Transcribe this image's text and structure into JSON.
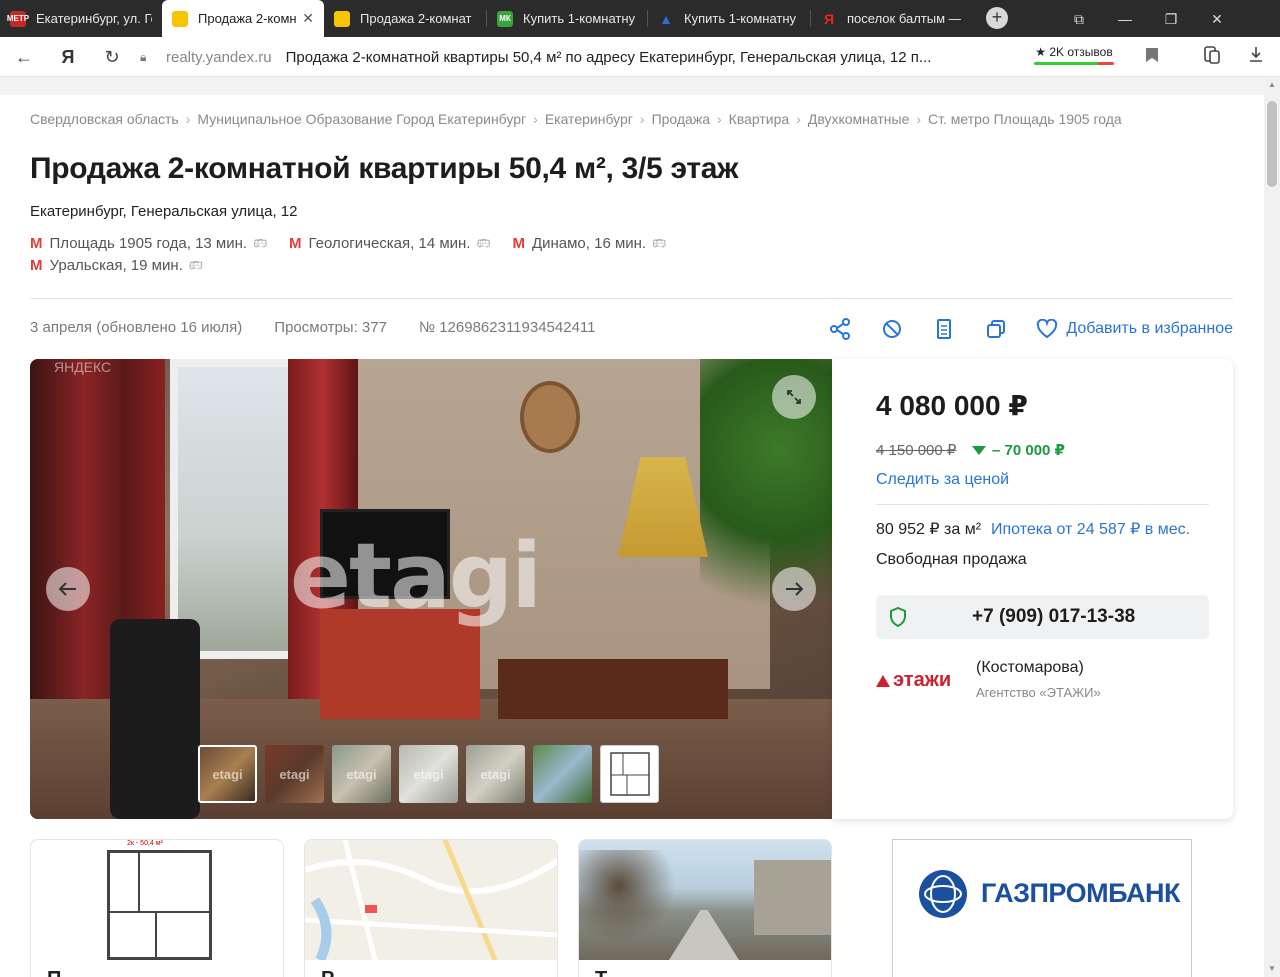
{
  "browser": {
    "tabs": [
      {
        "title": "Екатеринбург, ул. Ге",
        "favicon": "metro-red",
        "color": "#c62828"
      },
      {
        "title": "Продажа 2-комн",
        "favicon": "house-yellow",
        "color": "#f6c400",
        "active": true
      },
      {
        "title": "Продажа 2-комнат",
        "favicon": "house-yellow",
        "color": "#f6c400"
      },
      {
        "title": "Купить 1-комнатну",
        "favicon": "mk-green",
        "color": "#3aa33a"
      },
      {
        "title": "Купить 1-комнатну",
        "favicon": "triangle-blue",
        "color": "#2b6fd6"
      },
      {
        "title": "поселок балтым —",
        "favicon": "yandex-red",
        "color": "#e52620"
      }
    ],
    "favicon_text": {
      "metro": "МЕТР",
      "mk": "МК",
      "yandex": "Я"
    },
    "new_tab": "+",
    "window_buttons": {
      "collections": "⧉",
      "minimize": "—",
      "restore": "❐",
      "close": "✕"
    },
    "address": {
      "domain": "realty.yandex.ru",
      "page_title": "Продажа 2-комнатной квартиры 50,4 м² по адресу Екатеринбург, Генеральская улица, 12 п..."
    },
    "reviews": "★ 2K отзывов",
    "nav": {
      "back": "←",
      "yandex": "Я",
      "reload": "↻"
    }
  },
  "page": {
    "breadcrumbs": [
      "Свердловская область",
      "Муниципальное Образование Город Екатеринбург",
      "Екатеринбург",
      "Продажа",
      "Квартира",
      "Двухкомнатные",
      "Ст. метро Площадь 1905 года"
    ],
    "crumb_sep": "›",
    "title": "Продажа 2-комнатной квартиры 50,4 м², 3/5 этаж",
    "address": "Екатеринбург, Генеральская улица, 12",
    "metro": [
      {
        "station": "Площадь 1905 года, 13 мин."
      },
      {
        "station": "Геологическая, 14 мин."
      },
      {
        "station": "Динамо, 16 мин."
      },
      {
        "station": "Уральская, 19 мин."
      }
    ],
    "metro_mark": "М",
    "meta": {
      "date": "3 апреля (обновлено 16 июля)",
      "views": "Просмотры: 377",
      "id": "№ 1269862311934542411"
    },
    "actions": {
      "favorite": "Добавить в избранное"
    },
    "gallery": {
      "watermark": "etagi",
      "corner_mark": "ЯНДЕКС",
      "thumb_watermark": "etagi",
      "thumbnails": 7,
      "prev": "‹",
      "next": "›"
    },
    "card": {
      "price": "4 080 000 ₽",
      "old_price": "4 150 000 ₽",
      "discount": "– 70 000 ₽",
      "watch_price": "Следить за ценой",
      "price_per_m2": "80 952 ₽ за м²",
      "mortgage": "Ипотека от 24 587 ₽ в мес.",
      "sale_type": "Свободная продажа",
      "phone": "+7 (909) 017-13-38",
      "agency_logo": "этажи",
      "agent": "(Костомарова)",
      "agency": "Агентство «ЭТАЖИ»"
    },
    "bottom_cards": [
      {
        "caption": "П",
        "plan_title": "2к - 50,4 м²"
      },
      {
        "caption": "Р"
      },
      {
        "caption": "Т"
      }
    ],
    "ad": {
      "brand": "ГАЗПРОМБАНК"
    }
  }
}
